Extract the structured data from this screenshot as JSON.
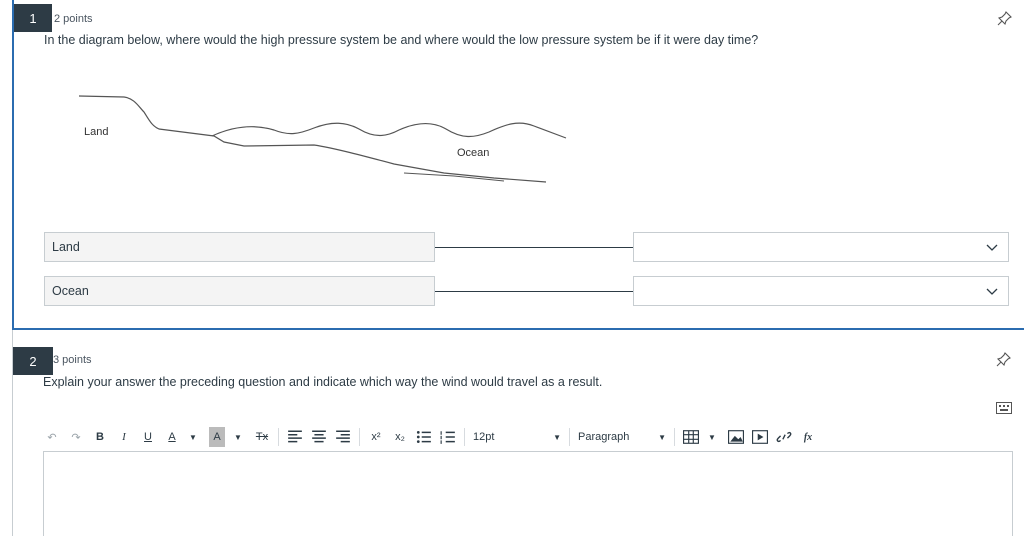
{
  "q1": {
    "number": "1",
    "points": "2 points",
    "text": "In the diagram below, where would the high pressure system be and where would the low pressure system be if it were day time?",
    "diagram": {
      "land_label": "Land",
      "ocean_label": "Ocean"
    },
    "rows": [
      {
        "label": "Land",
        "selected": ""
      },
      {
        "label": "Ocean",
        "selected": ""
      }
    ]
  },
  "q2": {
    "number": "2",
    "points": "3 points",
    "text": "Explain your answer the preceding question and indicate which way the wind would travel as a result.",
    "toolbar": {
      "undo": "↶",
      "redo": "↷",
      "bold": "B",
      "italic": "I",
      "underline": "U",
      "font_color": "A",
      "bg_color": "A",
      "clear_format": "Tx",
      "superscript": "x²",
      "subscript": "x₂",
      "font_size": "12pt",
      "block_format": "Paragraph",
      "formula": "fx"
    }
  }
}
